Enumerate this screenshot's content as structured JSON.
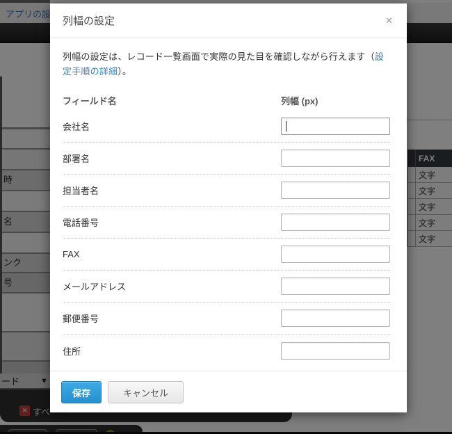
{
  "background": {
    "top_bar": {
      "app_settings_link": "アプリの設定"
    },
    "left_field_table": {
      "row_labels": [
        "時",
        "名",
        "ンク",
        "号"
      ]
    },
    "preview_table": {
      "header": "FAX",
      "cells": [
        "文字",
        "文字",
        "文字",
        "文字",
        "文字"
      ]
    },
    "view_dropdown": {
      "label": "ード",
      "caret_icon": "▼"
    },
    "filter_chip": {
      "remove_icon": "✕",
      "label": "すべ"
    }
  },
  "modal": {
    "title": "列幅の設定",
    "close_icon": "✕",
    "description": {
      "text": "列幅の設定は、レコード一覧画面で実際の見た目を確認しながら行えます（",
      "link": "設定手順の詳細",
      "suffix": "）。"
    },
    "column_headers": {
      "field_name": "フィールド名",
      "width_px": "列幅 (px)"
    },
    "fields": [
      {
        "label": "会社名",
        "value": ""
      },
      {
        "label": "部署名",
        "value": ""
      },
      {
        "label": "担当者名",
        "value": ""
      },
      {
        "label": "電話番号",
        "value": ""
      },
      {
        "label": "FAX",
        "value": ""
      },
      {
        "label": "メールアドレス",
        "value": ""
      },
      {
        "label": "郵便番号",
        "value": ""
      },
      {
        "label": "住所",
        "value": ""
      }
    ],
    "buttons": {
      "save": "保存",
      "cancel": "キャンセル"
    }
  },
  "colors": {
    "save_button_blue": "#2e96d5",
    "link_blue": "#3a7fc4",
    "remove_chip_red": "#c0443c",
    "preview_header_dark": "#343b41",
    "toolbar_black": "#2a2a2a",
    "overlay": "rgba(0,0,0,0.5)"
  }
}
